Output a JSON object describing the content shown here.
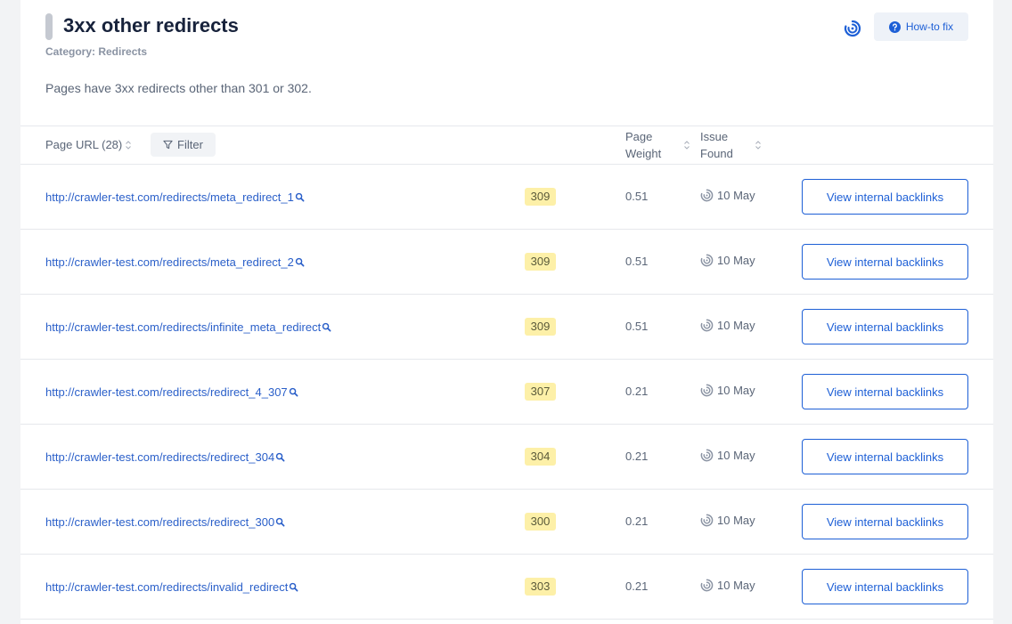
{
  "issue": {
    "title": "3xx other redirects",
    "category": "Category: Redirects",
    "description": "Pages have 3xx redirects other than 301 or 302.",
    "how_to_fix_label": "How-to fix"
  },
  "table": {
    "headers": {
      "page_url": "Page URL (28)",
      "filter": "Filter",
      "page_weight_line1": "Page",
      "page_weight_line2": "Weight",
      "issue_found_line1": "Issue",
      "issue_found_line2": "Found"
    },
    "rows": [
      {
        "url": "http://crawler-test.com/redirects/meta_redirect_1",
        "code": "309",
        "weight": "0.51",
        "found": "10 May",
        "action": "View internal backlinks"
      },
      {
        "url": "http://crawler-test.com/redirects/meta_redirect_2",
        "code": "309",
        "weight": "0.51",
        "found": "10 May",
        "action": "View internal backlinks"
      },
      {
        "url": "http://crawler-test.com/redirects/infinite_meta_redirect",
        "code": "309",
        "weight": "0.51",
        "found": "10 May",
        "action": "View internal backlinks"
      },
      {
        "url": "http://crawler-test.com/redirects/redirect_4_307",
        "code": "307",
        "weight": "0.21",
        "found": "10 May",
        "action": "View internal backlinks"
      },
      {
        "url": "http://crawler-test.com/redirects/redirect_304",
        "code": "304",
        "weight": "0.21",
        "found": "10 May",
        "action": "View internal backlinks"
      },
      {
        "url": "http://crawler-test.com/redirects/redirect_300",
        "code": "300",
        "weight": "0.21",
        "found": "10 May",
        "action": "View internal backlinks"
      },
      {
        "url": "http://crawler-test.com/redirects/invalid_redirect",
        "code": "303",
        "weight": "0.21",
        "found": "10 May",
        "action": "View internal backlinks"
      }
    ]
  },
  "colors": {
    "accent": "#1d5fd6",
    "link": "#2a5fc9",
    "badge_bg": "#fdf0a8"
  },
  "icons": {
    "brand": "brand-logo-icon",
    "help": "question-circle-icon",
    "filter": "funnel-icon",
    "sort": "sort-icon",
    "search": "magnifier-icon",
    "found": "crawler-logo-icon"
  }
}
